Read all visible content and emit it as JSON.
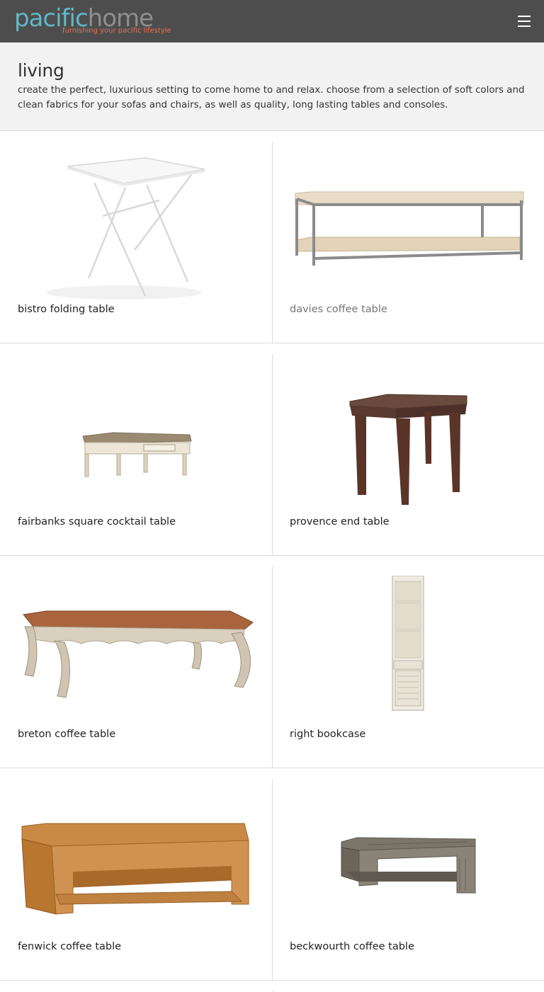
{
  "header": {
    "logo_part1": "pacific",
    "logo_part2": "home",
    "tagline": "furnishing your pacific lifestyle",
    "menu_icon": "hamburger-menu-icon"
  },
  "category": {
    "title": "living",
    "description": "create the perfect, luxurious setting to come home to and relax. choose from a selection of soft colors and clean fabrics for your sofas and chairs, as well as quality, long lasting tables and consoles."
  },
  "products": [
    {
      "name": "bistro folding table"
    },
    {
      "name": "davies coffee table"
    },
    {
      "name": "fairbanks square cocktail table"
    },
    {
      "name": "provence end table"
    },
    {
      "name": "breton coffee table"
    },
    {
      "name": "right bookcase"
    },
    {
      "name": "fenwick coffee table"
    },
    {
      "name": "beckwourth coffee table"
    }
  ],
  "colors": {
    "header_bg": "#4d4d4d",
    "logo_primary": "#5fb8c7",
    "logo_secondary": "#8e8e8e",
    "tagline": "#e8714f",
    "intro_bg": "#f2f2f2"
  }
}
